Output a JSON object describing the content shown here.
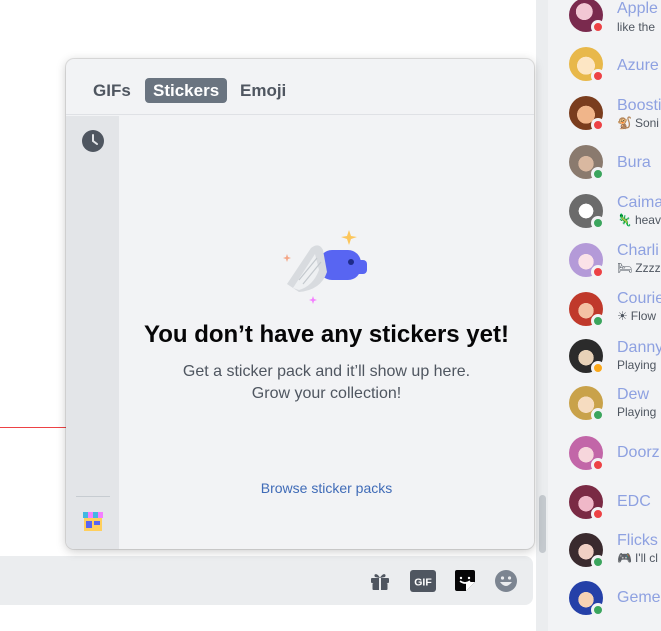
{
  "picker": {
    "tabs": [
      {
        "label": "GIFs",
        "active": false
      },
      {
        "label": "Stickers",
        "active": true
      },
      {
        "label": "Emoji",
        "active": false
      }
    ],
    "empty_title": "You don’t have any stickers yet!",
    "empty_desc_line1": "Get a sticker pack and it’ll show up here.",
    "empty_desc_line2": "Grow your collection!",
    "browse_link": "Browse sticker packs"
  },
  "composer": {
    "buttons": [
      "gift-icon",
      "gif-icon",
      "sticker-icon",
      "emoji-icon"
    ],
    "gif_label": "GIF"
  },
  "members": [
    {
      "name": "Apple",
      "activity": "like the",
      "status": "dnd"
    },
    {
      "name": "Azure",
      "activity": "",
      "status": "dnd"
    },
    {
      "name": "Boosti",
      "activity": "Soni",
      "status": "dnd"
    },
    {
      "name": "Bura",
      "activity": "",
      "status": "online"
    },
    {
      "name": "Caima",
      "activity": "heav",
      "status": "online"
    },
    {
      "name": "Charli",
      "activity": "Zzzz",
      "status": "dnd"
    },
    {
      "name": "Courie",
      "activity": "Flow",
      "status": "online"
    },
    {
      "name": "Danny",
      "activity": "Playing",
      "status": "idle"
    },
    {
      "name": "Dew",
      "activity": "Playing",
      "status": "online"
    },
    {
      "name": "Doorz",
      "activity": "",
      "status": "dnd"
    },
    {
      "name": "EDC",
      "activity": "",
      "status": "dnd"
    },
    {
      "name": "Flicks",
      "activity": "I'll cl",
      "status": "online"
    },
    {
      "name": "Geme",
      "activity": "",
      "status": "online"
    }
  ],
  "colors": {
    "dnd": "#ed4245",
    "online": "#3ba55d",
    "idle": "#faa81a",
    "member_name": "#8ea1e1",
    "active_tab": "#6a7480",
    "link": "#3f6bb7"
  }
}
